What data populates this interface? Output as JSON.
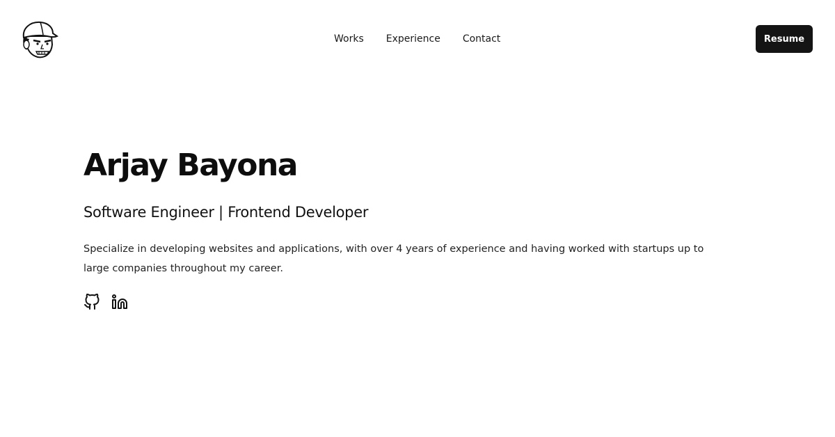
{
  "header": {
    "logo": {
      "icon": "cartoon-avatar-logo"
    },
    "nav": [
      {
        "label": "Works"
      },
      {
        "label": "Experience"
      },
      {
        "label": "Contact"
      }
    ],
    "resume_label": "Resume"
  },
  "hero": {
    "name": "Arjay Bayona",
    "role": "Software Engineer | Frontend Developer",
    "description": "Specialize in developing websites and applications, with over 4 years of experience and having worked with startups up to large companies throughout my career.",
    "socials": [
      {
        "icon": "github-icon"
      },
      {
        "icon": "linkedin-icon"
      }
    ]
  },
  "colors": {
    "background": "#ffffff",
    "text": "#111111",
    "button_bg": "#141414",
    "button_text": "#ffffff"
  }
}
